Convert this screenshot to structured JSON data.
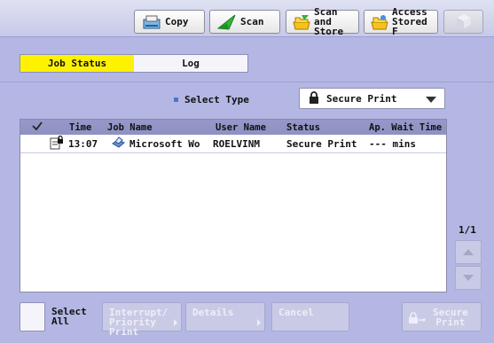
{
  "toolbar": {
    "copy_label": "Copy",
    "scan_label": "Scan",
    "scan_store_line1": "Scan and",
    "scan_store_line2": "Store",
    "access_line1": "Access",
    "access_line2": "Stored F"
  },
  "tabs": [
    {
      "label": "Job Status",
      "active": true
    },
    {
      "label": "Log",
      "active": false
    }
  ],
  "filter": {
    "select_type_label": "Select Type",
    "selected_value": "Secure Print"
  },
  "table": {
    "columns": [
      "Time",
      "Job Name",
      "User Name",
      "Status",
      "Ap. Wait Time"
    ],
    "rows": [
      {
        "time": "13:07",
        "job_name": "Microsoft Wo",
        "user_name": "ROELVINM",
        "status": "Secure Print",
        "wait": "--- mins"
      }
    ]
  },
  "pager": {
    "page": "1/1"
  },
  "bottom": {
    "select_all_line1": "Select",
    "select_all_line2": "All",
    "interrupt_line1": "Interrupt/",
    "interrupt_line2": "Priority Print",
    "details_label": "Details",
    "cancel_label": "Cancel",
    "secure_line1": "Secure",
    "secure_line2": "Print"
  },
  "colors": {
    "background": "#b4b7e3",
    "active_tab": "#fff200",
    "header": "#9698c9"
  }
}
